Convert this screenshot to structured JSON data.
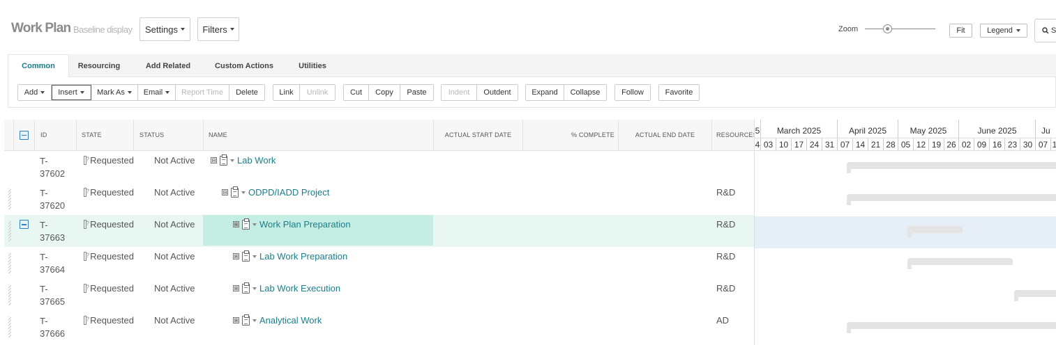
{
  "header": {
    "title": "Work Plan",
    "subtitle": "Baseline display",
    "settings_label": "Settings",
    "filters_label": "Filters",
    "zoom_label": "Zoom",
    "fit_label": "Fit",
    "legend_label": "Legend",
    "search_partial": "S"
  },
  "tabs": [
    "Common",
    "Resourcing",
    "Add Related",
    "Custom Actions",
    "Utilities"
  ],
  "toolbar": {
    "add": "Add",
    "insert": "Insert",
    "mark_as": "Mark As",
    "email": "Email",
    "report_time": "Report Time",
    "delete": "Delete",
    "link": "Link",
    "unlink": "Unlink",
    "cut": "Cut",
    "copy": "Copy",
    "paste": "Paste",
    "indent": "Indent",
    "outdent": "Outdent",
    "expand": "Expand",
    "collapse": "Collapse",
    "follow": "Follow",
    "favorite": "Favorite"
  },
  "columns": {
    "id": "ID",
    "state": "STATE",
    "status": "STATUS",
    "name": "NAME",
    "actual_start": "ACTUAL START DATE",
    "pct_complete": "% COMPLETE",
    "actual_end": "ACTUAL END DATE",
    "resources": "RESOURCES"
  },
  "rows": [
    {
      "id_prefix": "T-",
      "id_num": "37602",
      "state": "Requested",
      "status": "Not Active",
      "name": "Lab Work",
      "expander": "⊟",
      "resources": ""
    },
    {
      "id_prefix": "T-",
      "id_num": "37620",
      "state": "Requested",
      "status": "Not Active",
      "name": "ODPD/IADD Project",
      "expander": "⊟",
      "resources": "R&D"
    },
    {
      "id_prefix": "T-",
      "id_num": "37663",
      "state": "Requested",
      "status": "Not Active",
      "name": "Work Plan Preparation",
      "expander": "⊞",
      "resources": "R&D"
    },
    {
      "id_prefix": "T-",
      "id_num": "37664",
      "state": "Requested",
      "status": "Not Active",
      "name": "Lab Work Preparation",
      "expander": "⊞",
      "resources": "R&D"
    },
    {
      "id_prefix": "T-",
      "id_num": "37665",
      "state": "Requested",
      "status": "Not Active",
      "name": "Lab Work Execution",
      "expander": "⊞",
      "resources": "R&D"
    },
    {
      "id_prefix": "T-",
      "id_num": "37666",
      "state": "Requested",
      "status": "Not Active",
      "name": "Analytical Work",
      "expander": "⊞",
      "resources": "AD"
    }
  ],
  "gantt": {
    "months": [
      "5",
      "March 2025",
      "April 2025",
      "May 2025",
      "June 2025",
      "Ju"
    ],
    "days": [
      "4",
      "03",
      "10",
      "17",
      "24",
      "31",
      "07",
      "14",
      "21",
      "28",
      "05",
      "12",
      "19",
      "26",
      "02",
      "09",
      "16",
      "23",
      "30",
      "07",
      "1"
    ]
  }
}
